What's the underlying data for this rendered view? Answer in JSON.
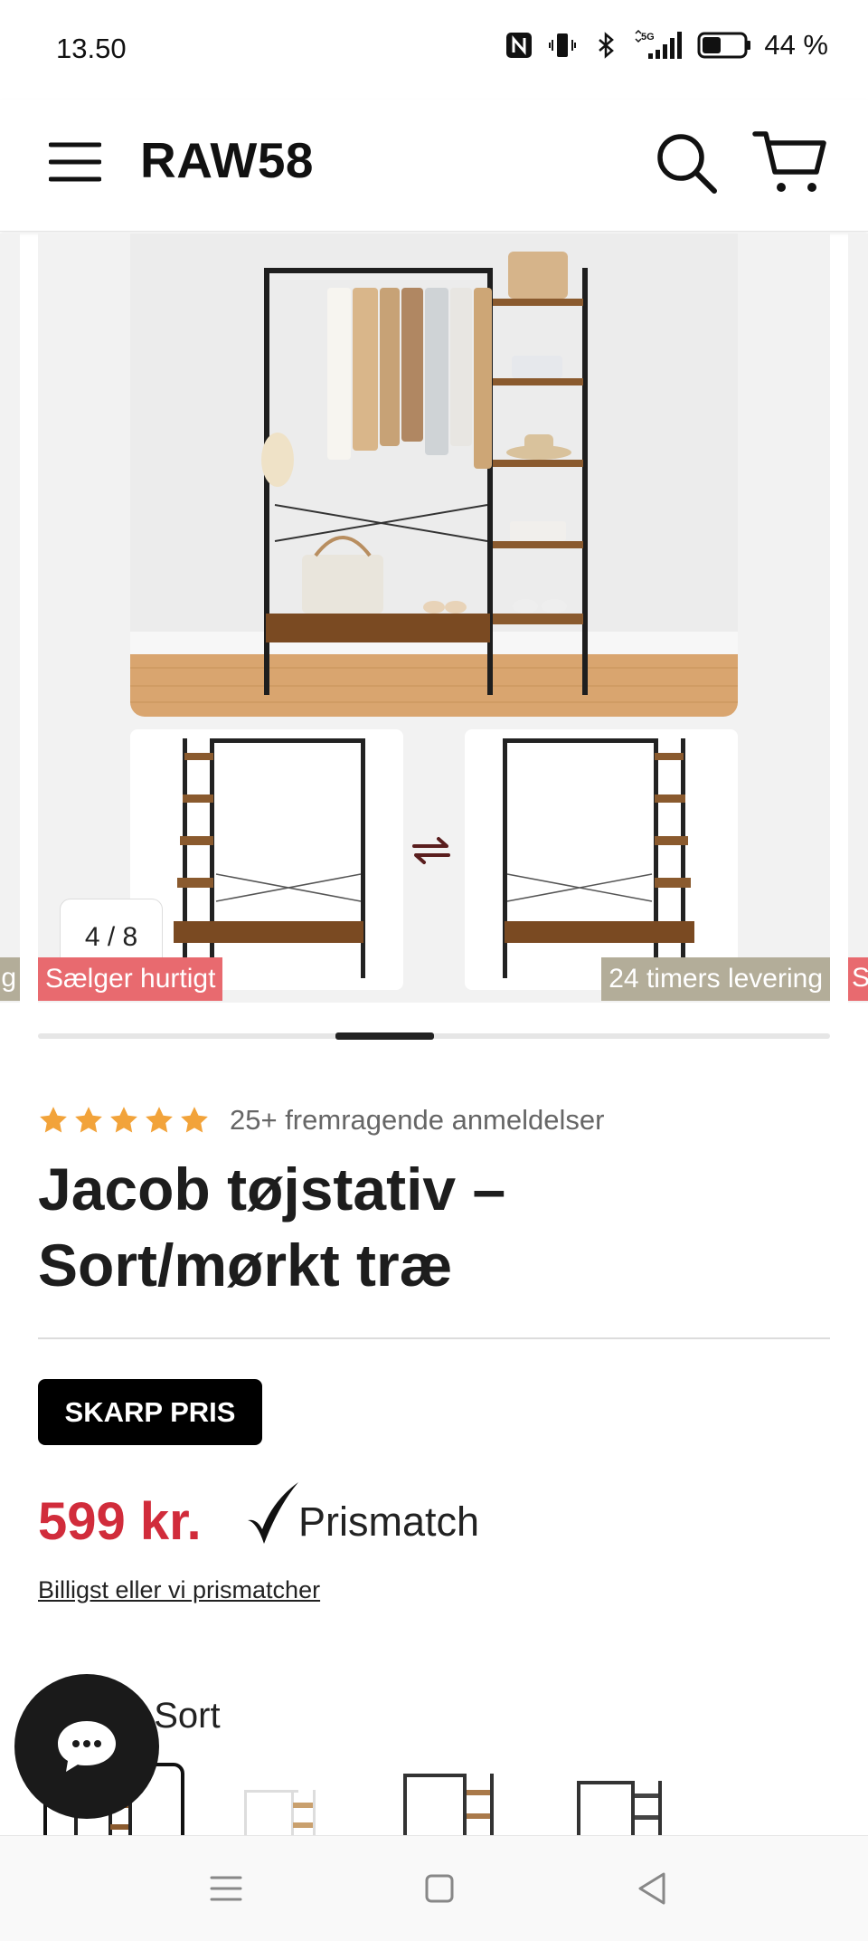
{
  "status_bar": {
    "time": "13.50",
    "battery": "44 %",
    "icons": [
      "nfc-icon",
      "vibrate-icon",
      "bluetooth-icon",
      "signal-5g-icon",
      "battery-icon"
    ]
  },
  "header": {
    "logo": "RAW58",
    "icons": [
      "hamburger-menu-icon",
      "search-icon",
      "cart-icon"
    ]
  },
  "gallery": {
    "counter": "4 / 8",
    "badge_left": "Sælger hurtigt",
    "badge_right": "24 timers levering",
    "edge_left_text": "g",
    "edge_right_text": "S",
    "current_index": 4,
    "total": 8,
    "progress_fraction": 0.125,
    "progress_start_fraction": 0.375
  },
  "product": {
    "rating_stars": 5,
    "reviews_text": "25+ fremragende anmeldelser",
    "title_line1": "Jacob tøjstativ –",
    "title_line2": "Sort/mørkt træ",
    "promo_badge": "SKARP PRIS",
    "price": "599 kr.",
    "prismatch": "Prismatch",
    "price_link": "Billigst eller vi prismatcher",
    "color_label": ": Sort"
  },
  "colors": {
    "accent_red": "#d12c3b",
    "badge_red": "#e86a6f",
    "badge_tan": "#b3ad99",
    "star_orange": "#f2a33a"
  }
}
